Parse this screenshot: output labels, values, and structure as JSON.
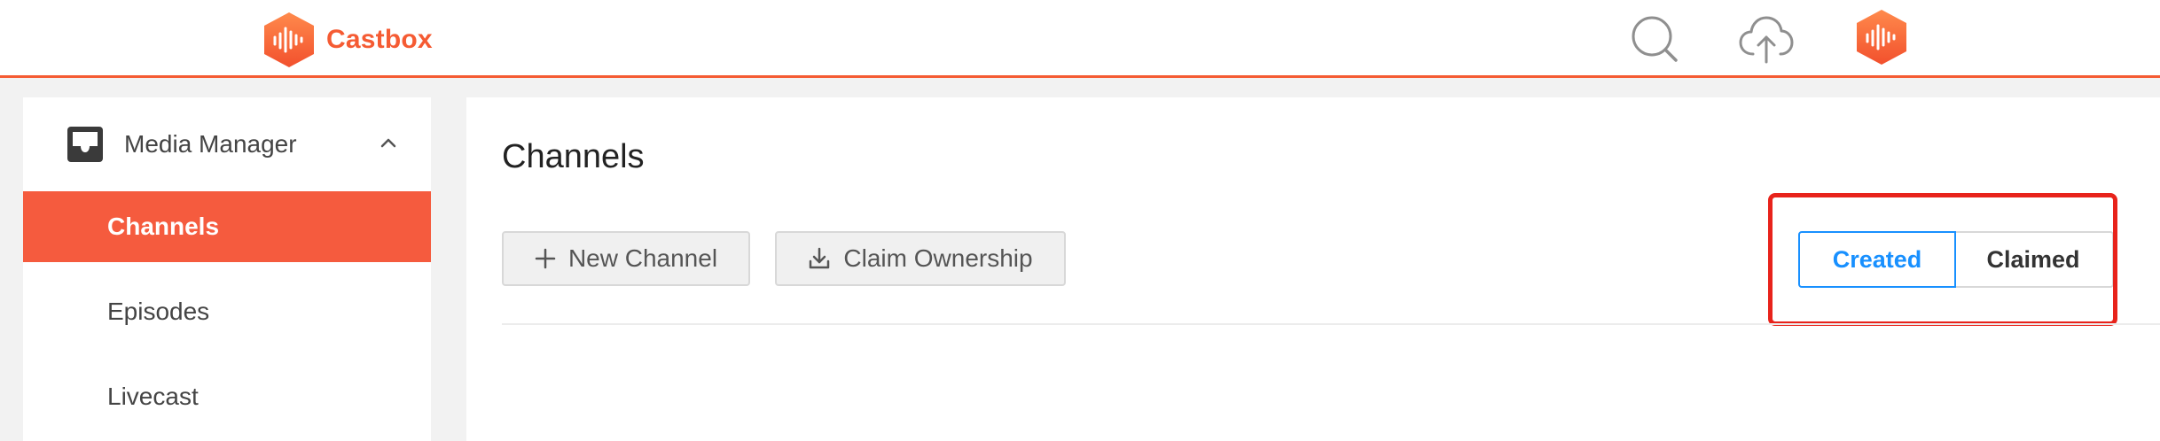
{
  "header": {
    "app_name": "Castbox",
    "icons": [
      "castbox-logo-icon",
      "search-icon",
      "upload-cloud-icon",
      "avatar-icon"
    ],
    "accent_color": "#f55b33"
  },
  "sidebar": {
    "section": {
      "label": "Media Manager",
      "icon": "inbox-icon",
      "expanded": true
    },
    "items": [
      {
        "label": "Channels",
        "active": true
      },
      {
        "label": "Episodes",
        "active": false
      },
      {
        "label": "Livecast",
        "active": false
      }
    ]
  },
  "main": {
    "title": "Channels",
    "actions": {
      "new_channel": "New Channel",
      "claim_ownership": "Claim Ownership"
    },
    "filter": {
      "options": [
        "Created",
        "Claimed"
      ],
      "selected": "Created",
      "selected_color": "#1890ff"
    },
    "highlight_color": "#e8231b"
  }
}
